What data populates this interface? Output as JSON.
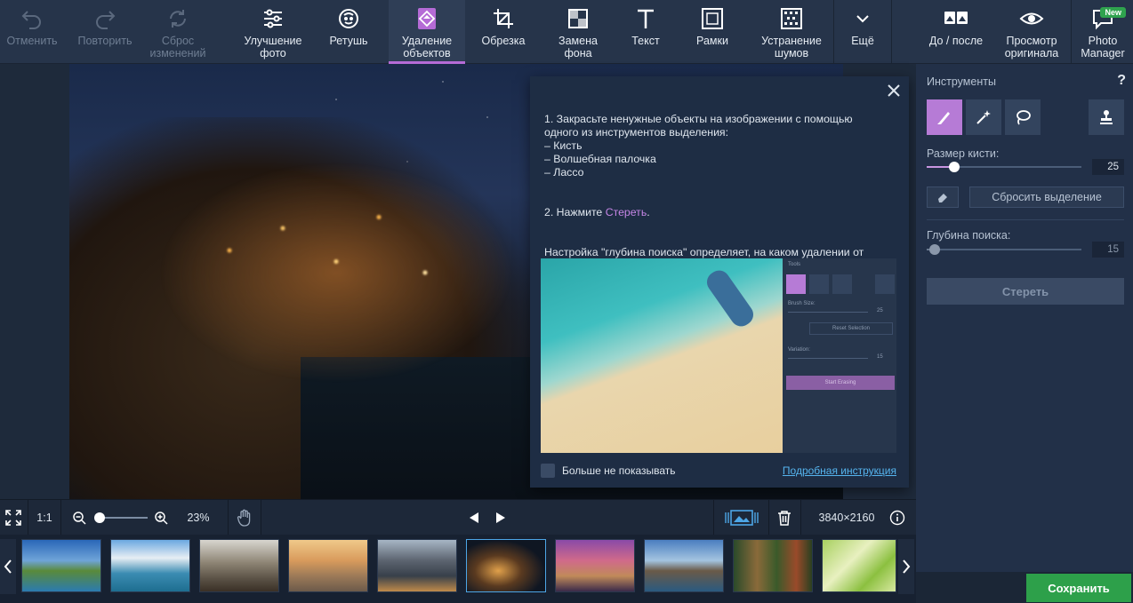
{
  "toolbar": {
    "undo": "Отменить",
    "redo": "Повторить",
    "reset": "Сброс\nизменений",
    "enhance": "Улучшение\nфото",
    "retouch": "Ретушь",
    "remove_objects": "Удаление\nобъектов",
    "crop": "Обрезка",
    "replace_bg": "Замена\nфона",
    "text": "Текст",
    "frames": "Рамки",
    "denoise": "Устранение\nшумов",
    "more": "Ещё",
    "before_after": "До / после",
    "view_original": "Просмотр\nоригинала",
    "photo_manager": "Photo\nManager",
    "new_badge": "New"
  },
  "help": {
    "steps": "1. Закрасьте ненужные объекты на изображении с помощью одного из инструментов выделения:\n– Кисть\n– Волшебная палочка\n– Лассо",
    "step2_prefix": "2. Нажмите ",
    "step2_link": "Стереть",
    "step2_suffix": ".",
    "depth_note": "Настройка \"глубина поиска\" определяет, на каком удалении от объекта будут взяты пиксели для заполнения выделенной области.",
    "dont_show": "Больше не показывать",
    "detailed": "Подробная инструкция",
    "mini": {
      "tools": "Tools",
      "brush_size": "Brush Size:",
      "brush_val": "25",
      "reset_sel": "Reset Selection",
      "variation": "Variation:",
      "var_val": "15",
      "start": "Start Erasing"
    }
  },
  "status": {
    "ratio": "1:1",
    "zoom": "23%",
    "resolution": "3840×2160"
  },
  "panel": {
    "tools_title": "Инструменты",
    "help": "?",
    "brush_size_label": "Размер кисти:",
    "brush_size": "25",
    "brush_size_fraction": 0.18,
    "reset_selection": "Сбросить выделение",
    "search_depth_label": "Глубина поиска:",
    "search_depth": "15",
    "search_depth_fraction": 0.05,
    "erase": "Стереть",
    "save": "Сохранить"
  },
  "colors": {
    "accent": "#b56bd6",
    "save": "#2da04a",
    "link": "#55b4ee"
  }
}
